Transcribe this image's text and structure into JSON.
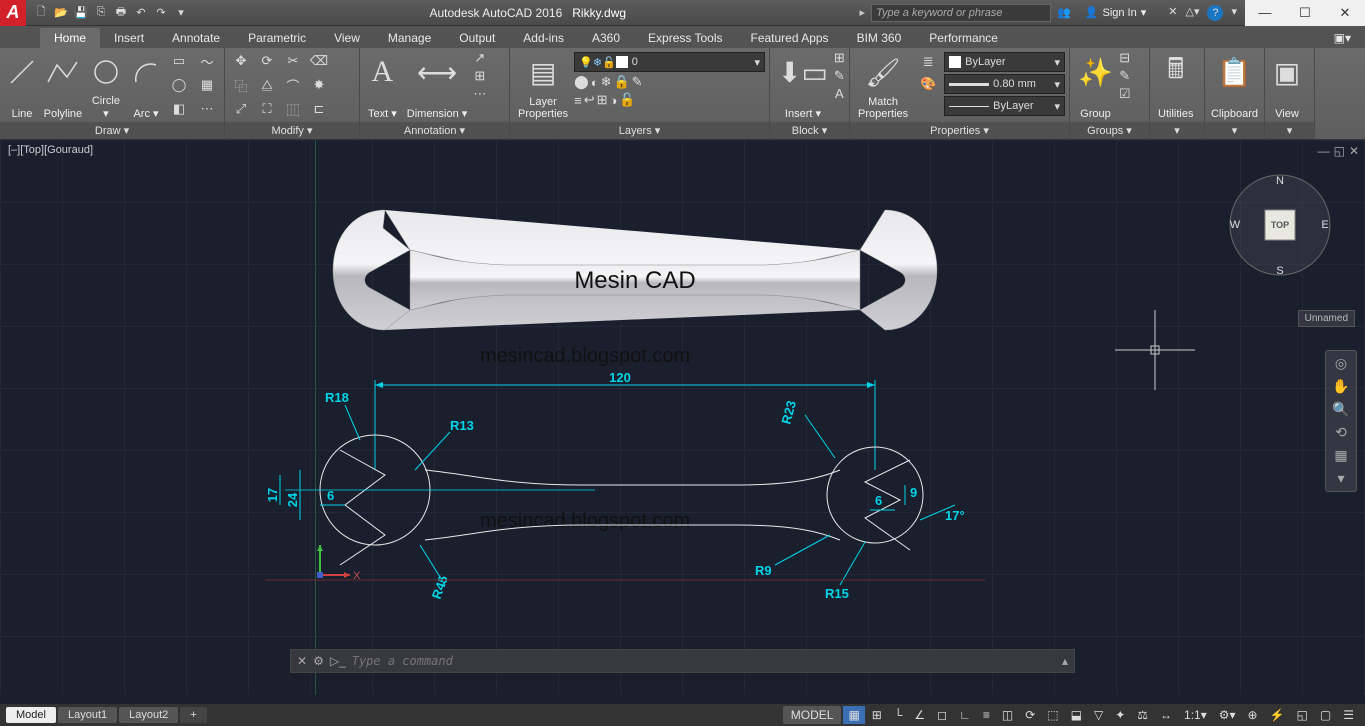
{
  "title": {
    "app": "Autodesk AutoCAD 2016",
    "file": "Rikky.dwg"
  },
  "search": {
    "placeholder": "Type a keyword or phrase"
  },
  "signin": "Sign In",
  "tabs": [
    "Home",
    "Insert",
    "Annotate",
    "Parametric",
    "View",
    "Manage",
    "Output",
    "Add-ins",
    "A360",
    "Express Tools",
    "Featured Apps",
    "BIM 360",
    "Performance"
  ],
  "active_tab": "Home",
  "ribbon": {
    "draw": {
      "title": "Draw ▾",
      "line": "Line",
      "polyline": "Polyline",
      "circle": "Circle",
      "arc": "Arc"
    },
    "modify": {
      "title": "Modify ▾"
    },
    "annotation": {
      "title": "Annotation ▾",
      "text": "Text",
      "dim": "Dimension"
    },
    "layers": {
      "title": "Layers ▾",
      "props": "Layer\nProperties",
      "layer0": "0"
    },
    "block": {
      "title": "Block ▾",
      "insert": "Insert"
    },
    "properties": {
      "title": "Properties ▾",
      "match": "Match\nProperties",
      "bylayer": "ByLayer",
      "lw": "0.80 mm"
    },
    "groups": {
      "title": "Groups ▾",
      "group": "Group"
    },
    "utilities": {
      "title": "Utilities"
    },
    "clipboard": {
      "title": "Clipboard"
    },
    "view": {
      "title": "View"
    }
  },
  "viewport_label": "[–][Top][Gouraud]",
  "viewcube": {
    "top": "TOP",
    "n": "N",
    "s": "S",
    "e": "E",
    "w": "W"
  },
  "ucs_name": "Unnamed",
  "cmd": {
    "placeholder": "Type a command"
  },
  "model_tabs": [
    "Model",
    "Layout1",
    "Layout2"
  ],
  "active_model": "Model",
  "status": {
    "model": "MODEL",
    "scale": "1:1"
  },
  "drawing": {
    "title_text": "Mesin CAD",
    "watermark": "mesincad.blogspot.com",
    "dims": {
      "overall": "120",
      "r18": "R18",
      "r13": "R13",
      "r23": "R23",
      "r9": "R9",
      "r15": "R15",
      "r45": "R45",
      "h17_l": "17",
      "h17_r": "17°",
      "h9": "9",
      "w6_l": "6",
      "w6_r": "6",
      "h24": "24"
    }
  }
}
